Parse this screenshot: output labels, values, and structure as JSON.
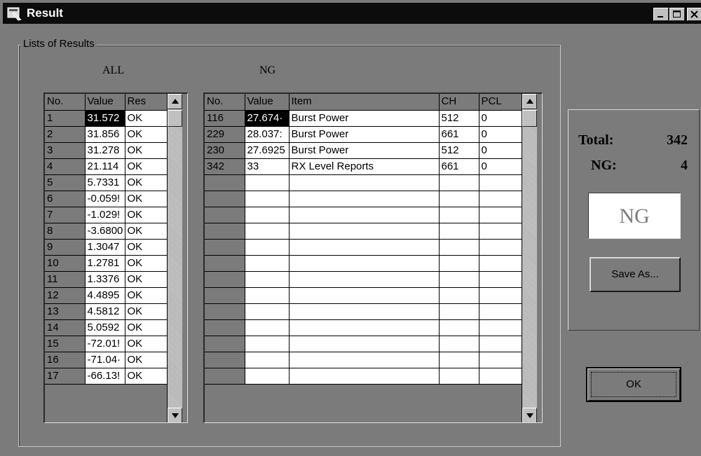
{
  "window": {
    "title": "Result",
    "icon": "app-window-icon",
    "controls": [
      "minimize-icon",
      "maximize-icon",
      "close-icon"
    ]
  },
  "group": {
    "title": "Lists of Results",
    "all_caption": "ALL",
    "ng_caption": "NG"
  },
  "all_table": {
    "columns": [
      "No.",
      "Value",
      "Res"
    ],
    "rows": [
      [
        "1",
        "31.572",
        "OK"
      ],
      [
        "2",
        "31.856",
        "OK"
      ],
      [
        "3",
        "31.278",
        "OK"
      ],
      [
        "4",
        "21.114",
        "OK"
      ],
      [
        "5",
        "5.7331",
        "OK"
      ],
      [
        "6",
        "-0.059!",
        "OK"
      ],
      [
        "7",
        "-1.029!",
        "OK"
      ],
      [
        "8",
        "-3.6800",
        "OK"
      ],
      [
        "9",
        "1.3047",
        "OK"
      ],
      [
        "10",
        "1.2781",
        "OK"
      ],
      [
        "11",
        "1.3376",
        "OK"
      ],
      [
        "12",
        "4.4895",
        "OK"
      ],
      [
        "13",
        "4.5812",
        "OK"
      ],
      [
        "14",
        "5.0592",
        "OK"
      ],
      [
        "15",
        "-72.01!",
        "OK"
      ],
      [
        "16",
        "-71.04·",
        "OK"
      ],
      [
        "17",
        "-66.13!",
        "OK"
      ]
    ],
    "selected_row": 0
  },
  "ng_table": {
    "columns": [
      "No.",
      "Value",
      "Item",
      "CH",
      "PCL"
    ],
    "rows": [
      [
        "116",
        "27.674·",
        "Burst Power",
        "512",
        "0"
      ],
      [
        "229",
        "28.037:",
        "Burst Power",
        "661",
        "0"
      ],
      [
        "230",
        "27.6925",
        "Burst Power",
        "512",
        "0"
      ],
      [
        "342",
        "33",
        "RX Level Reports",
        "661",
        "0"
      ]
    ],
    "empty_rows": 13,
    "selected_row": 0
  },
  "summary": {
    "total_label": "Total:",
    "total_value": "342",
    "ng_label": "NG:",
    "ng_value": "4",
    "result": "NG"
  },
  "buttons": {
    "save_as": "Save As...",
    "ok": "OK"
  }
}
